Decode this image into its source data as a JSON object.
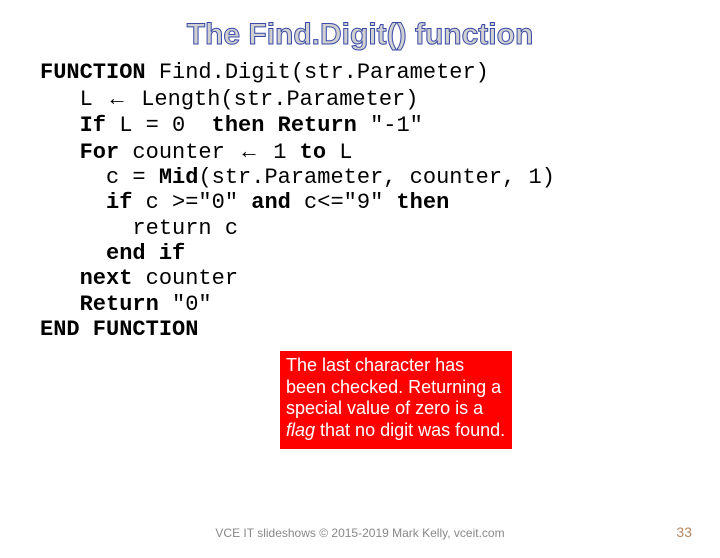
{
  "title": "The Find.Digit() function",
  "code": {
    "l1a": "FUNCTION",
    "l1b": " Find.Digit(str.Parameter)",
    "l2a": "   L ",
    "l2arrow": "←",
    "l2b": " Length(str.Parameter)",
    "l3a": "   If",
    "l3b": " L = 0  ",
    "l3c": "then Return",
    "l3d": " \"-1\"",
    "l4a": "   For",
    "l4b": " counter ",
    "l4arrow": "←",
    "l4c": " 1 ",
    "l4d": "to",
    "l4e": " L",
    "l5a": "     c = ",
    "l5b": "Mid",
    "l5c": "(str.Parameter, counter, 1)",
    "l6a": "     if",
    "l6b": " c >=\"0\" ",
    "l6c": "and",
    "l6d": " c<=\"9\" ",
    "l6e": "then",
    "l7": "       return c",
    "l8a": "     end if",
    "l9a": "   next",
    "l9b": " counter",
    "l10a": "   Return",
    "l10b": " \"0\"",
    "l11a": "END FUNCTION"
  },
  "callout": {
    "t1": "The last character has been checked. Returning a special value of zero is a ",
    "flag": "flag",
    "t2": " that no digit was found."
  },
  "footer": "VCE IT slideshows © 2015-2019 Mark Kelly, vceit.com",
  "pagenum": "33"
}
